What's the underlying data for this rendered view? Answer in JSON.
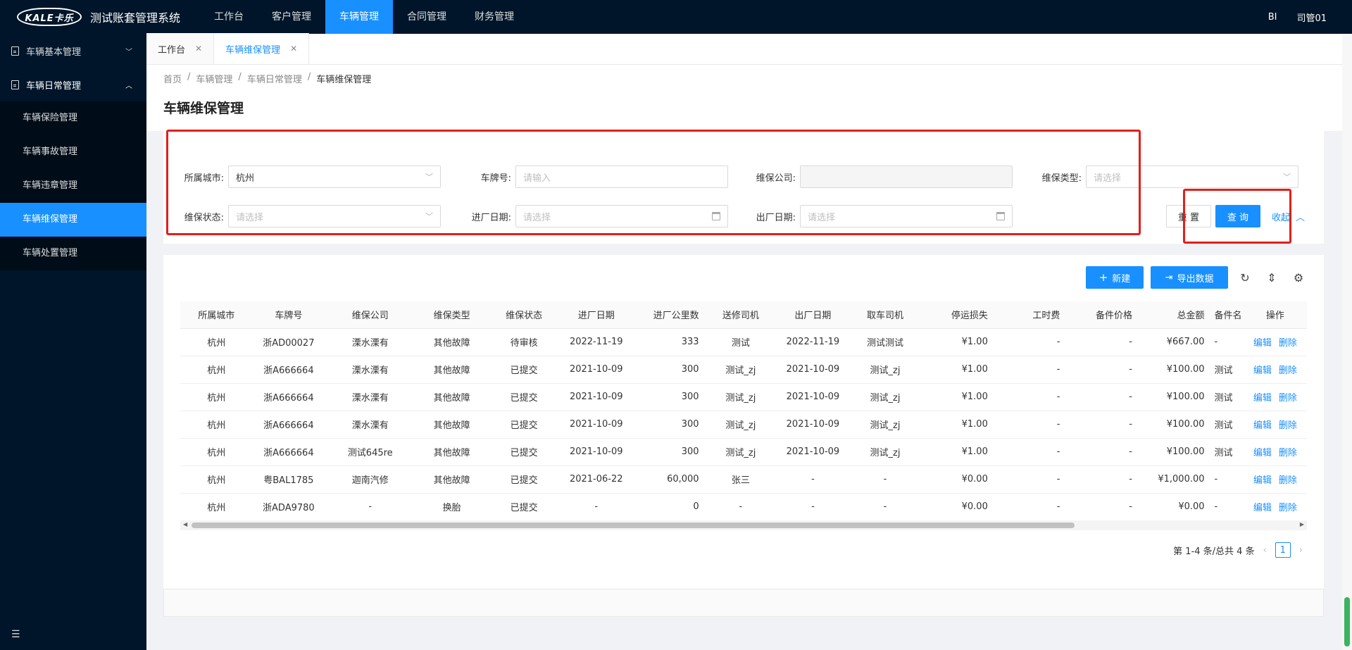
{
  "app": {
    "title": "测试账套管理系统",
    "logo_text": "KALE卡乐"
  },
  "topnav": [
    {
      "label": "工作台",
      "active": false
    },
    {
      "label": "客户管理",
      "active": false
    },
    {
      "label": "车辆管理",
      "active": true
    },
    {
      "label": "合同管理",
      "active": false
    },
    {
      "label": "财务管理",
      "active": false
    }
  ],
  "topright": {
    "bi": "BI",
    "user": "司管01"
  },
  "sidebar": {
    "groups": [
      {
        "label": "车辆基本管理",
        "open": false
      },
      {
        "label": "车辆日常管理",
        "open": true
      }
    ],
    "subitems": [
      {
        "label": "车辆保险管理",
        "active": false
      },
      {
        "label": "车辆事故管理",
        "active": false
      },
      {
        "label": "车辆违章管理",
        "active": false
      },
      {
        "label": "车辆维保管理",
        "active": true
      },
      {
        "label": "车辆处置管理",
        "active": false
      }
    ]
  },
  "tabs": [
    {
      "label": "工作台",
      "active": false
    },
    {
      "label": "车辆维保管理",
      "active": true
    }
  ],
  "breadcrumb": [
    "首页",
    "车辆管理",
    "车辆日常管理",
    "车辆维保管理"
  ],
  "page_title": "车辆维保管理",
  "search": {
    "city": {
      "label": "所属城市:",
      "value": "杭州"
    },
    "plate": {
      "label": "车牌号:",
      "placeholder": "请输入"
    },
    "company": {
      "label": "维保公司:",
      "value": ""
    },
    "type": {
      "label": "维保类型:",
      "placeholder": "请选择"
    },
    "status": {
      "label": "维保状态:",
      "placeholder": "请选择"
    },
    "in_date": {
      "label": "进厂日期:",
      "placeholder": "请选择"
    },
    "out_date": {
      "label": "出厂日期:",
      "placeholder": "请选择"
    },
    "reset": "重 置",
    "query": "查 询",
    "collapse": "收起"
  },
  "toolbar": {
    "add": "新建",
    "export": "导出数据"
  },
  "table": {
    "columns": [
      "所属城市",
      "车牌号",
      "维保公司",
      "维保类型",
      "维保状态",
      "进厂日期",
      "进厂公里数",
      "送修司机",
      "出厂日期",
      "取车司机",
      "停运损失",
      "工时费",
      "备件价格",
      "总金额",
      "备件名",
      "操作"
    ],
    "rows": [
      [
        "杭州",
        "浙AD00027",
        "溧水溧有",
        "其他故障",
        "待审核",
        "2022-11-19",
        "333",
        "测试",
        "2022-11-19",
        "测试测试",
        "¥1.00",
        "-",
        "-",
        "¥667.00",
        "-"
      ],
      [
        "杭州",
        "浙A666664",
        "溧水溧有",
        "其他故障",
        "已提交",
        "2021-10-09",
        "300",
        "测试_zj",
        "2021-10-09",
        "测试_zj",
        "¥1.00",
        "-",
        "-",
        "¥100.00",
        "测试"
      ],
      [
        "杭州",
        "浙A666664",
        "溧水溧有",
        "其他故障",
        "已提交",
        "2021-10-09",
        "300",
        "测试_zj",
        "2021-10-09",
        "测试_zj",
        "¥1.00",
        "-",
        "-",
        "¥100.00",
        "测试"
      ],
      [
        "杭州",
        "浙A666664",
        "溧水溧有",
        "其他故障",
        "已提交",
        "2021-10-09",
        "300",
        "测试_zj",
        "2021-10-09",
        "测试_zj",
        "¥1.00",
        "-",
        "-",
        "¥100.00",
        "测试"
      ],
      [
        "杭州",
        "浙A666664",
        "测试645re",
        "其他故障",
        "已提交",
        "2021-10-09",
        "300",
        "测试_zj",
        "2021-10-09",
        "测试_zj",
        "¥1.00",
        "-",
        "-",
        "¥100.00",
        "测试"
      ],
      [
        "杭州",
        "粤BAL1785",
        "迦南汽修",
        "其他故障",
        "已提交",
        "2021-06-22",
        "60,000",
        "张三",
        "-",
        "-",
        "¥0.00",
        "-",
        "-",
        "¥1,000.00",
        "-"
      ],
      [
        "杭州",
        "浙ADA9780",
        "-",
        "换胎",
        "已提交",
        "-",
        "0",
        "-",
        "-",
        "-",
        "¥0.00",
        "-",
        "-",
        "¥0.00",
        "-"
      ]
    ],
    "ops": {
      "edit": "编辑",
      "delete": "删除"
    }
  },
  "pagination": {
    "summary": "第 1-4 条/总共 4 条",
    "current": "1"
  },
  "colors": {
    "primary": "#1890ff",
    "nav_bg": "#001529",
    "highlight": "#e0201a"
  },
  "icons": [
    "menu-fold-icon",
    "reload-icon",
    "column-height-icon",
    "setting-icon",
    "plus-icon",
    "export-icon",
    "calendar-icon",
    "chevron-down-icon",
    "chevron-up-icon",
    "close-icon"
  ]
}
